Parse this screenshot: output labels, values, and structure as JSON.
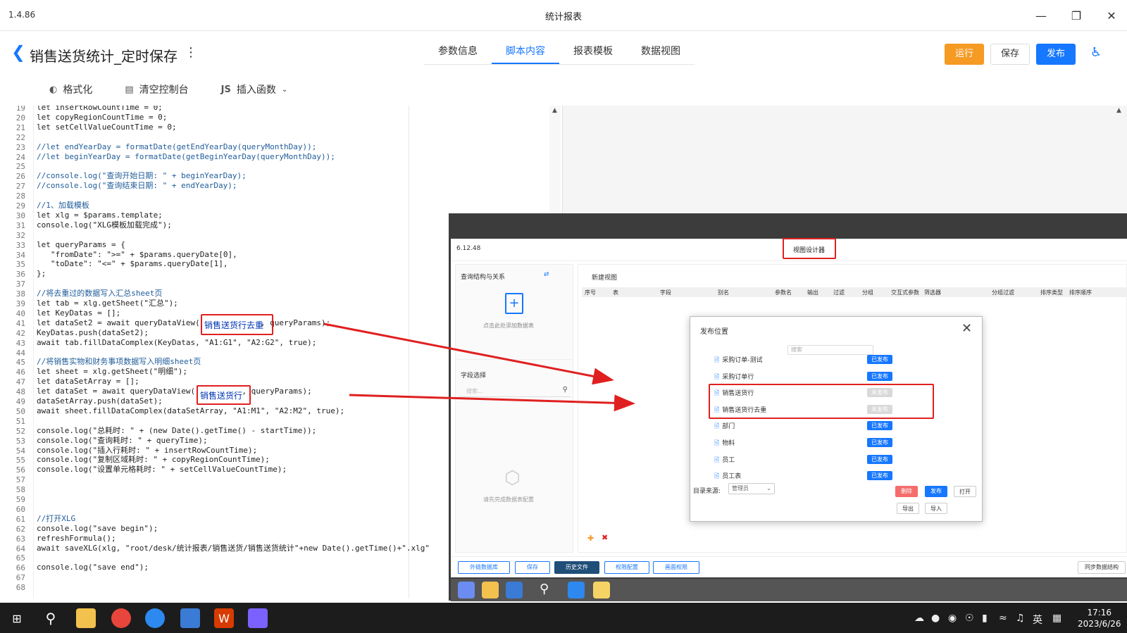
{
  "window": {
    "version": "1.4.86",
    "title": "统计报表"
  },
  "header": {
    "page_title": "销售送货统计_定时保存"
  },
  "tabs": [
    {
      "label": "参数信息"
    },
    {
      "label": "脚本内容"
    },
    {
      "label": "报表模板"
    },
    {
      "label": "数据视图"
    }
  ],
  "actions": {
    "run": "运行",
    "save": "保存",
    "publish": "发布"
  },
  "toolbar": {
    "format": "格式化",
    "clear_console": "清空控制台",
    "js_badge": "JS",
    "insert_function": "插入函数"
  },
  "editor": {
    "lines": [
      {
        "n": "19",
        "text": "let insertRowCountTime = 0;"
      },
      {
        "n": "20",
        "text": "let copyRegionCountTime = 0;"
      },
      {
        "n": "21",
        "text": "let setCellValueCountTime = 0;"
      },
      {
        "n": "22",
        "text": ""
      },
      {
        "n": "23",
        "text": "//let endYearDay = formatDate(getEndYearDay(queryMonthDay));"
      },
      {
        "n": "24",
        "text": "//let beginYearDay = formatDate(getBeginYearDay(queryMonthDay));"
      },
      {
        "n": "25",
        "text": ""
      },
      {
        "n": "26",
        "text": "//console.log(\"查询开始日期: \" + beginYearDay);"
      },
      {
        "n": "27",
        "text": "//console.log(\"查询结束日期: \" + endYearDay);"
      },
      {
        "n": "28",
        "text": ""
      },
      {
        "n": "29",
        "text": "//1、加载模板"
      },
      {
        "n": "30",
        "text": "let xlg = $params.template;"
      },
      {
        "n": "31",
        "text": "console.log(\"XLG模板加载完成\");"
      },
      {
        "n": "32",
        "text": ""
      },
      {
        "n": "33",
        "text": "let queryParams = {"
      },
      {
        "n": "34",
        "text": "   \"fromDate\": \">=\" + $params.queryDate[0],"
      },
      {
        "n": "35",
        "text": "   \"toDate\": \"<=\" + $params.queryDate[1],"
      },
      {
        "n": "36",
        "text": "};"
      },
      {
        "n": "37",
        "text": ""
      },
      {
        "n": "38",
        "text": "//将去重过的数据写入汇总sheet页"
      },
      {
        "n": "39",
        "text": "let tab = xlg.getSheet(\"汇总\");"
      },
      {
        "n": "40",
        "text": "let KeyDatas = [];"
      },
      {
        "n": "41",
        "text": "let dataSet2 = await queryDataView(             , queryParams);"
      },
      {
        "n": "42",
        "text": "KeyDatas.push(dataSet2);"
      },
      {
        "n": "43",
        "text": "await tab.fillDataComplex(KeyDatas, \"A1:G1\", \"A2:G2\", true);"
      },
      {
        "n": "44",
        "text": ""
      },
      {
        "n": "45",
        "text": "//将销售实物和财务事项数据写入明细sheet页"
      },
      {
        "n": "46",
        "text": "let sheet = xlg.getSheet(\"明细\");"
      },
      {
        "n": "47",
        "text": "let dataSetArray = [];"
      },
      {
        "n": "48",
        "text": "let dataSet = await queryDataView(          , queryParams);"
      },
      {
        "n": "49",
        "text": "dataSetArray.push(dataSet);"
      },
      {
        "n": "50",
        "text": "await sheet.fillDataComplex(dataSetArray, \"A1:M1\", \"A2:M2\", true);"
      },
      {
        "n": "51",
        "text": ""
      },
      {
        "n": "52",
        "text": "console.log(\"总耗时: \" + (new Date().getTime() - startTime));"
      },
      {
        "n": "53",
        "text": "console.log(\"查询耗时: \" + queryTime);"
      },
      {
        "n": "54",
        "text": "console.log(\"插入行耗时: \" + insertRowCountTime);"
      },
      {
        "n": "55",
        "text": "console.log(\"复制区域耗时: \" + copyRegionCountTime);"
      },
      {
        "n": "56",
        "text": "console.log(\"设置单元格耗时: \" + setCellValueCountTime);"
      },
      {
        "n": "57",
        "text": ""
      },
      {
        "n": "58",
        "text": ""
      },
      {
        "n": "59",
        "text": ""
      },
      {
        "n": "60",
        "text": ""
      },
      {
        "n": "61",
        "text": "//打开XLG"
      },
      {
        "n": "62",
        "text": "console.log(\"save begin\");"
      },
      {
        "n": "63",
        "text": "refreshFormula();"
      },
      {
        "n": "64",
        "text": "await saveXLG(xlg, \"root/desk/统计报表/销售送货/销售送货统计\"+new Date().getTime()+\".xlg\""
      },
      {
        "n": "65",
        "text": ""
      },
      {
        "n": "66",
        "text": "console.log(\"save end\");"
      },
      {
        "n": "67",
        "text": ""
      },
      {
        "n": "68",
        "text": ""
      }
    ],
    "highlight_1": "销售送货行去重",
    "highlight_2": "销售送货行"
  },
  "view_designer": {
    "version": "6.12.48",
    "title": "视图设计器",
    "query_section": "查询结构与关系",
    "add_table_hint": "点击此处添加数据表",
    "field_select": "字段选择",
    "field_search_placeholder": "搜索...",
    "config_hint": "请先完成数据表配置",
    "new_view": "新建视图",
    "grid_headers": [
      "序号",
      "表",
      "字段",
      "别名",
      "参数名",
      "输出",
      "过滤",
      "分组",
      "交互式参数",
      "筛选器",
      "分组过滤",
      "排序类型",
      "排序顺序"
    ],
    "bottom_buttons": {
      "external_db": "外链数据库",
      "save": "保存",
      "history": "历史文件",
      "perm_config": "权限配置",
      "page_perm": "画面权限",
      "sync_structure": "同步数据结构"
    }
  },
  "publish_dialog": {
    "title": "发布位置",
    "search_placeholder": "搜索",
    "items": [
      {
        "label": "采购订单-测试",
        "status": "已发布"
      },
      {
        "label": "采购订单行",
        "status": "已发布"
      },
      {
        "label": "销售送货行",
        "status": "未发布"
      },
      {
        "label": "销售送货行去重",
        "status": "未发布"
      },
      {
        "label": "部门",
        "status": "已发布"
      },
      {
        "label": "物料",
        "status": "已发布"
      },
      {
        "label": "员工",
        "status": "已发布"
      },
      {
        "label": "员工表",
        "status": "已发布"
      }
    ],
    "source_label": "目录来源:",
    "source_value": "管理员",
    "btn_delete": "删除",
    "btn_publish": "发布",
    "btn_open": "打开",
    "btn_export": "导出",
    "btn_import": "导入"
  },
  "taskbar": {
    "ime": "英",
    "time": "17:16",
    "date": "2023/6/26"
  },
  "colors": {
    "accent": "#1677ff",
    "run": "#f59a23",
    "highlight_box": "#e02020"
  }
}
